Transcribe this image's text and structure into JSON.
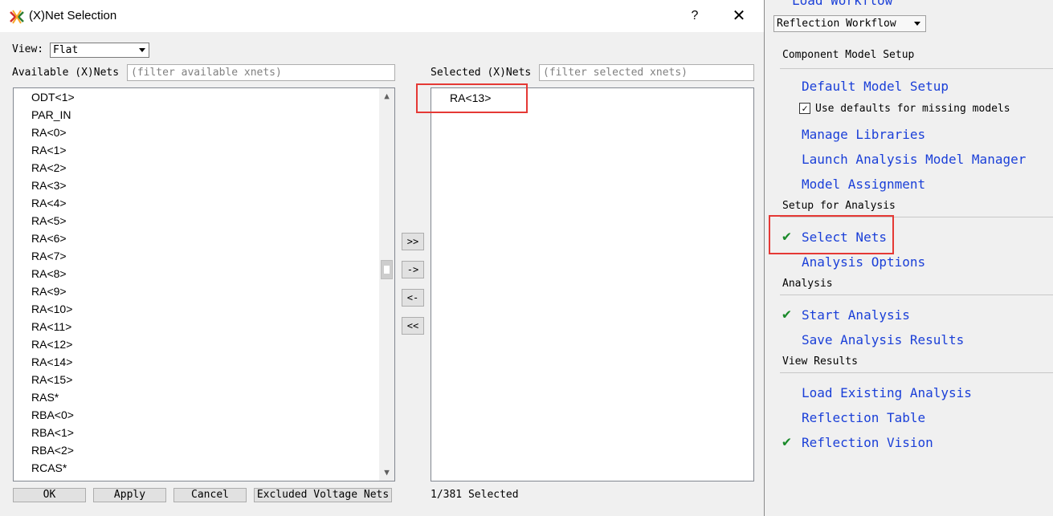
{
  "dialog": {
    "title": "(X)Net Selection",
    "help": "?",
    "close": "✕",
    "view_label": "View:",
    "view_value": "Flat",
    "available_label": "Available (X)Nets",
    "available_filter_placeholder": "(filter available xnets)",
    "available_items": [
      "ODT<1>",
      "PAR_IN",
      "RA<0>",
      "RA<1>",
      "RA<2>",
      "RA<3>",
      "RA<4>",
      "RA<5>",
      "RA<6>",
      "RA<7>",
      "RA<8>",
      "RA<9>",
      "RA<10>",
      "RA<11>",
      "RA<12>",
      "RA<14>",
      "RA<15>",
      "RAS*",
      "RBA<0>",
      "RBA<1>",
      "RBA<2>",
      "RCAS*"
    ],
    "move_buttons": [
      ">>",
      "->",
      "<-",
      "<<"
    ],
    "selected_label": "Selected (X)Nets",
    "selected_filter_placeholder": "(filter selected xnets)",
    "selected_items": [
      "RA<13>"
    ],
    "buttons": {
      "ok": "OK",
      "apply": "Apply",
      "cancel": "Cancel",
      "excluded": "Excluded Voltage Nets"
    },
    "selected_count": "1/381 Selected"
  },
  "panel": {
    "top_link": "Load Workflow",
    "workflow_value": "Reflection Workflow",
    "sections": {
      "component_model_setup": "Component Model Setup",
      "setup_for_analysis": "Setup for Analysis",
      "analysis": "Analysis",
      "view_results": "View Results"
    },
    "links": {
      "default_model_setup": "Default Model Setup",
      "use_defaults": "Use defaults for missing models",
      "manage_libraries": "Manage Libraries",
      "launch_model_manager": "Launch Analysis Model Manager",
      "model_assignment": "Model Assignment",
      "select_nets": "Select Nets",
      "analysis_options": "Analysis Options",
      "start_analysis": "Start Analysis",
      "save_results": "Save Analysis Results",
      "load_existing": "Load Existing Analysis",
      "reflection_table": "Reflection Table",
      "reflection_vision": "Reflection Vision"
    },
    "check_glyph": "✔",
    "checkbox_glyph": "✓"
  },
  "colors": {
    "link": "#1a3fd8",
    "check": "#1a8a2a",
    "highlight": "#e53935"
  }
}
